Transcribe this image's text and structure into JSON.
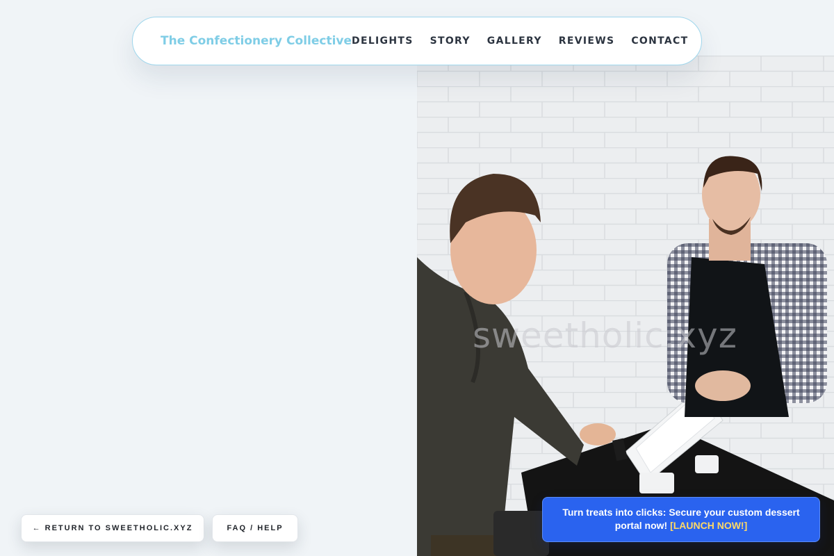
{
  "header": {
    "brand": "The Confectionery Collective",
    "nav": [
      "DELIGHTS",
      "STORY",
      "GALLERY",
      "REVIEWS",
      "CONTACT"
    ]
  },
  "hero": {
    "watermark": "sweetholic.xyz",
    "image_icon": "cafe-checkout-photo"
  },
  "footer_buttons": {
    "return_label": "← RETURN TO SWEETHOLIC.XYZ",
    "faq_label": "FAQ / HELP"
  },
  "promo": {
    "text": "Turn treats into clicks: Secure your custom dessert portal now! ",
    "cta": "[LAUNCH NOW!]"
  },
  "colors": {
    "background": "#f0f4f7",
    "brand": "#7fcde6",
    "promo_bg": "#2a63ef",
    "promo_cta": "#ffd966"
  }
}
